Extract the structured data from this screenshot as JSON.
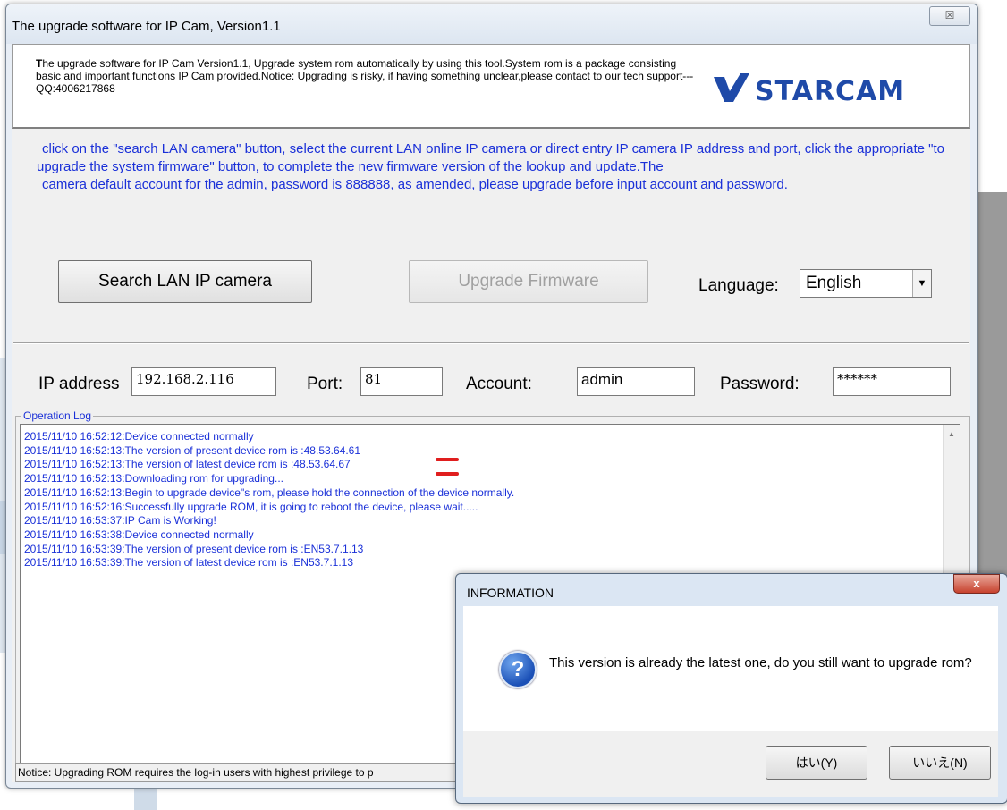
{
  "window": {
    "title": "The upgrade software for IP Cam, Version1.1",
    "close_glyph": "☒"
  },
  "header": {
    "description_first": "T",
    "description_rest": "he upgrade software for IP Cam Version1.1, Upgrade system rom automatically by using this tool.System rom is a package consisting basic and important functions IP Cam provided.Notice: Upgrading is risky, if having something unclear,please contact to our tech support---QQ:4006217868",
    "logo_text": "STARCAM"
  },
  "instructions": {
    "line1": "click on the \"search LAN camera\" button, select the current LAN online IP camera or direct entry IP camera IP address and port, click the appropriate \"to upgrade the system firmware\" button, to complete the new firmware version of the lookup and update.The",
    "line2": "camera default account for the admin, password is 888888, as amended, please upgrade before input account and password."
  },
  "buttons": {
    "search": "Search LAN IP camera",
    "upgrade": "Upgrade Firmware"
  },
  "language": {
    "label": "Language:",
    "selected": "English"
  },
  "fields": {
    "ip_label": "IP address",
    "ip_value": "192.168.2.116",
    "port_label": "Port:",
    "port_value": "81",
    "account_label": "Account:",
    "account_value": "admin",
    "password_label": "Password:",
    "password_value": "******"
  },
  "log": {
    "legend": "Operation Log",
    "lines": [
      "2015/11/10 16:52:12:Device connected normally",
      "2015/11/10 16:52:13:The version of present device rom is :48.53.64.61",
      "2015/11/10 16:52:13:The version of latest  device rom is :48.53.64.67",
      "2015/11/10 16:52:13:Downloading rom for upgrading...",
      "2015/11/10 16:52:13:Begin to upgrade device\"s rom, please hold the connection of the device normally.",
      "2015/11/10 16:52:16:Successfully upgrade ROM, it is going to reboot the device, please wait.....",
      "2015/11/10 16:53:37:IP Cam is Working!",
      "2015/11/10 16:53:38:Device connected normally",
      "2015/11/10 16:53:39:The version of present device rom is :EN53.7.1.13",
      "2015/11/10 16:53:39:The version of latest  device rom is :EN53.7.1.13"
    ]
  },
  "status_bar": {
    "text": "Notice: Upgrading  ROM requires  the log-in users with highest privilege to p"
  },
  "dialog": {
    "title": "INFORMATION",
    "close_glyph": "x",
    "icon_glyph": "?",
    "message": "This version is already the latest one, do you still want to upgrade rom?",
    "yes": "はい(Y)",
    "no": "いいえ(N)"
  },
  "colors": {
    "log_text": "#1a30d8",
    "highlight": "#e01e1e"
  }
}
